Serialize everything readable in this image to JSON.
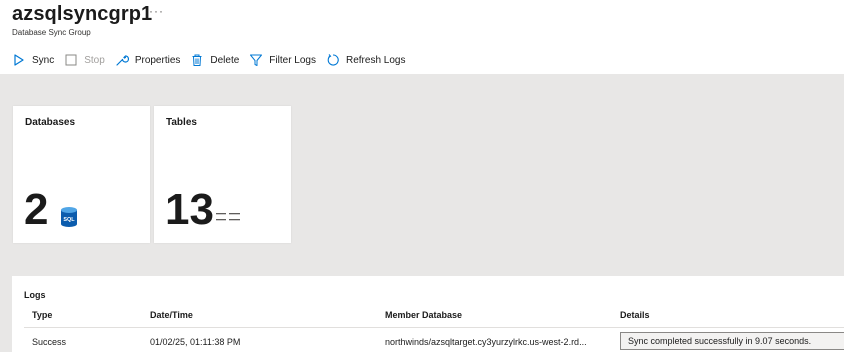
{
  "header": {
    "title": "azsqlsyncgrp1",
    "more": "···",
    "subtitle": "Database Sync Group"
  },
  "toolbar": {
    "sync_label": "Sync",
    "stop_label": "Stop",
    "properties_label": "Properties",
    "delete_label": "Delete",
    "filter_logs_label": "Filter Logs",
    "refresh_logs_label": "Refresh Logs"
  },
  "cards": {
    "databases": {
      "title": "Databases",
      "count": "2",
      "icon": "sql-database-icon"
    },
    "tables": {
      "title": "Tables",
      "count": "13",
      "icon": "table-list-icon"
    }
  },
  "logs": {
    "title": "Logs",
    "columns": [
      "Type",
      "Date/Time",
      "Member Database",
      "Details"
    ],
    "rows": [
      {
        "type": "Success",
        "datetime": "01/02/25, 01:11:38 PM",
        "member_database": "northwinds/azsqltarget.cy3yurzylrkc.us-west-2.rd...",
        "details": "Sync completed successfully in 9.07 seconds."
      }
    ]
  },
  "colors": {
    "accent": "#0078d4",
    "background": "#e8e7e6",
    "card": "#ffffff",
    "disabled": "#a19f9d"
  }
}
